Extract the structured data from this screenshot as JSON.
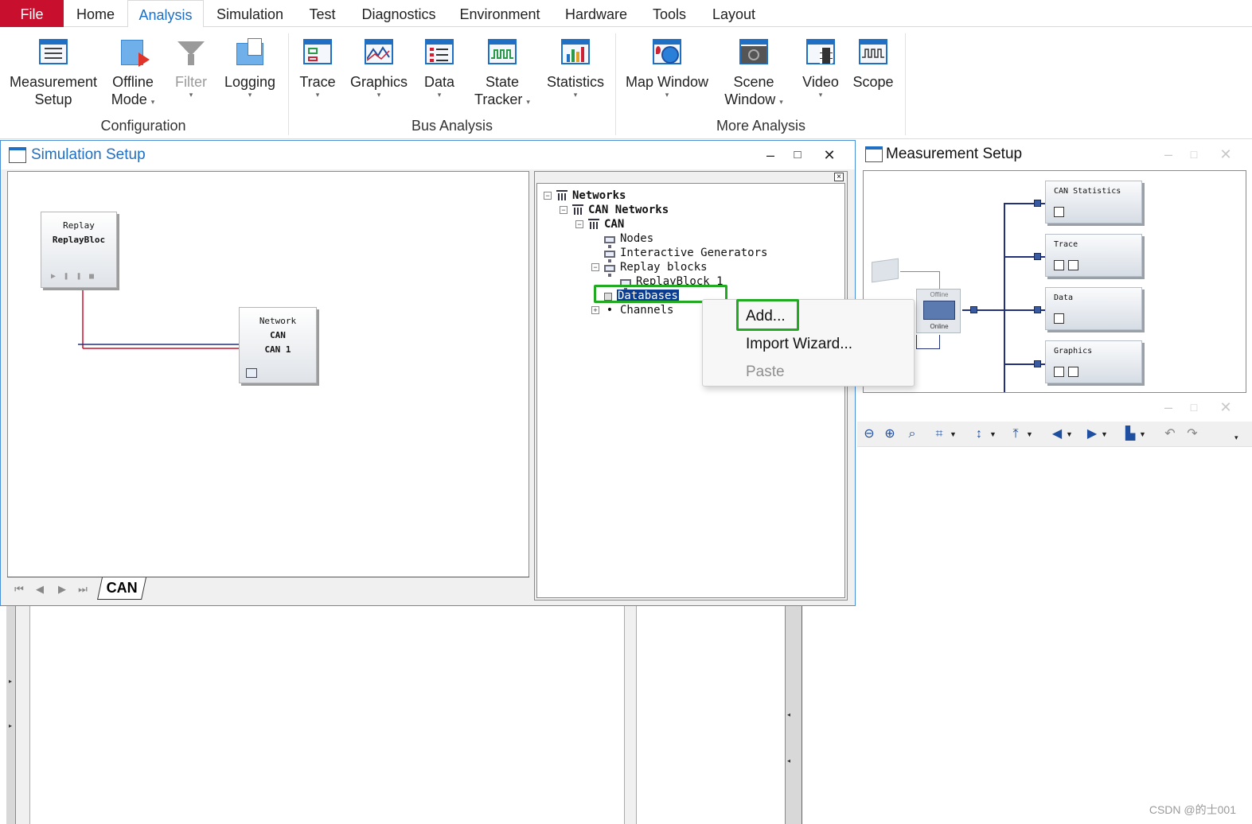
{
  "menubar": {
    "tabs": [
      "File",
      "Home",
      "Analysis",
      "Simulation",
      "Test",
      "Diagnostics",
      "Environment",
      "Hardware",
      "Tools",
      "Layout"
    ],
    "active": "Analysis"
  },
  "ribbon": {
    "buttons": {
      "measurement_setup": [
        "Measurement",
        "Setup"
      ],
      "offline_mode": [
        "Offline",
        "Mode"
      ],
      "filter": "Filter",
      "logging": "Logging",
      "trace": "Trace",
      "graphics": "Graphics",
      "data": "Data",
      "state_tracker": [
        "State",
        "Tracker"
      ],
      "statistics": "Statistics",
      "map_window": "Map Window",
      "scene_window": [
        "Scene",
        "Window"
      ],
      "video": "Video",
      "scope": "Scope"
    },
    "groups": {
      "configuration": "Configuration",
      "bus_analysis": "Bus Analysis",
      "more_analysis": "More Analysis"
    }
  },
  "simulation_setup": {
    "title": "Simulation Setup",
    "controls": {
      "minimize": "–",
      "maximize": "□",
      "close": "✕"
    },
    "replay_block": {
      "line1": "Replay",
      "line2": "ReplayBloc"
    },
    "network_block": {
      "line1": "Network",
      "line2": "CAN",
      "line3": "CAN 1"
    },
    "sheet_tab": "CAN",
    "tree": {
      "networks": "Networks",
      "can_networks": "CAN Networks",
      "can": "CAN",
      "nodes": "Nodes",
      "interactive_generators": "Interactive Generators",
      "replay_blocks": "Replay blocks",
      "replay_block_1": "ReplayBlock 1",
      "databases": "Databases",
      "channels": "Channels"
    }
  },
  "context_menu": {
    "items": [
      "Add...",
      "Import Wizard...",
      "Paste"
    ],
    "disabled": [
      "Paste"
    ]
  },
  "measurement_setup": {
    "title": "Measurement Setup",
    "offline_label": "Offline",
    "online_label": "Online",
    "blocks": [
      "CAN Statistics",
      "Trace",
      "Data",
      "Graphics"
    ]
  },
  "watermark": "CSDN @的士001",
  "colors": {
    "accent": "#1f6fc4",
    "file_tab": "#c8102e",
    "highlight": "#22aa22",
    "selection": "#0a3d91"
  }
}
